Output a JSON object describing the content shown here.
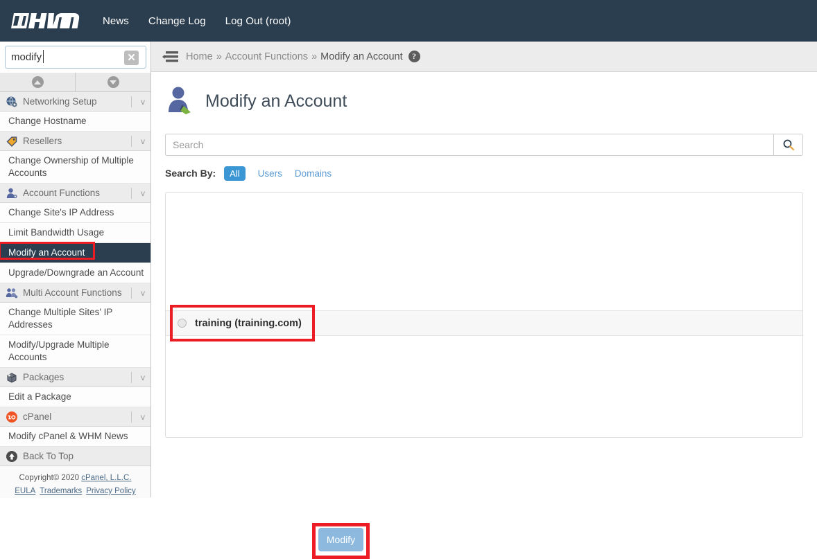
{
  "topnav": {
    "logo_text": "WHM",
    "links": [
      {
        "label": "News",
        "name": "news"
      },
      {
        "label": "Change Log",
        "name": "change-log"
      },
      {
        "label": "Log Out (root)",
        "name": "log-out"
      }
    ]
  },
  "sidebar": {
    "search": {
      "value": "modify",
      "placeholder": ""
    },
    "scroll_up_icon": "chevron-up-icon",
    "scroll_down_icon": "chevron-down-icon",
    "clear_icon": "clear-x-icon",
    "nav": [
      {
        "type": "group",
        "label": "Networking Setup",
        "icon": "globe-icon",
        "chevron": "v"
      },
      {
        "type": "item",
        "label": "Change Hostname",
        "active": false
      },
      {
        "type": "group",
        "label": "Resellers",
        "icon": "tag-icon",
        "chevron": "v"
      },
      {
        "type": "item",
        "label": "Change Ownership of Multiple Accounts",
        "active": false
      },
      {
        "type": "group",
        "label": "Account Functions",
        "icon": "user-icon",
        "chevron": "v"
      },
      {
        "type": "item",
        "label": "Change Site's IP Address",
        "active": false
      },
      {
        "type": "item",
        "label": "Limit Bandwidth Usage",
        "active": false
      },
      {
        "type": "item",
        "label": "Modify an Account",
        "active": true
      },
      {
        "type": "item",
        "label": "Upgrade/Downgrade an Account",
        "active": false
      },
      {
        "type": "group",
        "label": "Multi Account Functions",
        "icon": "users-icon",
        "chevron": "v"
      },
      {
        "type": "item",
        "label": "Change Multiple Sites' IP Addresses",
        "active": false
      },
      {
        "type": "item",
        "label": "Modify/Upgrade Multiple Accounts",
        "active": false
      },
      {
        "type": "group",
        "label": "Packages",
        "icon": "package-icon",
        "chevron": "v"
      },
      {
        "type": "item",
        "label": "Edit a Package",
        "active": false
      },
      {
        "type": "group",
        "label": "cPanel",
        "icon": "cpanel-icon",
        "chevron": "v"
      },
      {
        "type": "item",
        "label": "Modify cPanel & WHM News",
        "active": false
      }
    ],
    "back_to_top": {
      "label": "Back To Top",
      "icon": "arrow-up-circle-icon"
    },
    "footer": {
      "copyright_prefix": "Copyright© 2020 ",
      "copyright_link": "cPanel, L.L.C.",
      "eula": "EULA",
      "trademarks": "Trademarks",
      "privacy": "Privacy Policy"
    }
  },
  "breadcrumb": {
    "menu_icon": "hamburger-icon",
    "home": "Home",
    "sep": "»",
    "section": "Account Functions",
    "current": "Modify an Account",
    "help_icon": "help-circle-icon",
    "help_glyph": "?"
  },
  "main": {
    "title": "Modify an Account",
    "title_icon": "user-edit-icon",
    "search": {
      "placeholder": "Search",
      "value": "",
      "button_icon": "search-icon"
    },
    "search_by": {
      "label": "Search By:",
      "options": [
        {
          "label": "All",
          "selected": true
        },
        {
          "label": "Users",
          "selected": false
        },
        {
          "label": "Domains",
          "selected": false
        }
      ]
    },
    "accounts": [
      {
        "label": "training (training.com)",
        "user": "training",
        "domain": "training.com",
        "selected": false
      }
    ],
    "submit_label": "Modify"
  },
  "colors": {
    "header_navy": "#2b3e50",
    "accent_blue": "#3b97d3",
    "link_blue": "#5b9bd5",
    "highlight_red": "#ec1c24",
    "button_blue": "#8cb9dd",
    "sidebar_bg": "#fafafa"
  }
}
